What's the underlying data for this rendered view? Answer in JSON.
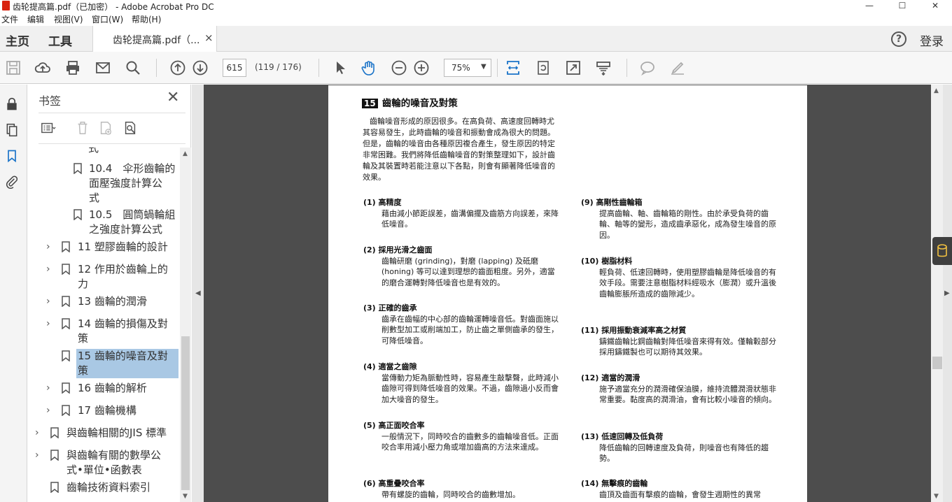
{
  "window": {
    "title": "齿轮提高篇.pdf（已加密） - Adobe Acrobat Pro DC",
    "minimize": "—",
    "maximize": "☐",
    "close": "✕"
  },
  "menu": [
    "文件",
    "编辑",
    "视图(V)",
    "窗口(W)",
    "帮助(H)"
  ],
  "tabs": {
    "home": "主页",
    "tools": "工具",
    "document": "齿轮提高篇.pdf（...",
    "close": "×",
    "help": "?",
    "login": "登录"
  },
  "toolbar": {
    "page_number": "615",
    "page_count": "(119 / 176)",
    "zoom": "75%"
  },
  "bookmarks": {
    "title": "书签",
    "close": "✕",
    "items": [
      {
        "text": "式"
      },
      {
        "text": "10.4　伞形齒輪的"
      },
      {
        "text": "面壓強度計算公"
      },
      {
        "text": "式"
      },
      {
        "text": "10.5　圓筒蝸輪組"
      },
      {
        "text": "之強度計算公式"
      },
      {
        "text": "11 塑膠齒輪的設計"
      },
      {
        "text": "12 作用於齒輪上的"
      },
      {
        "text": "力"
      },
      {
        "text": "13 齒輪的潤滑"
      },
      {
        "text": "14 齒輪的損傷及對"
      },
      {
        "text": "策"
      },
      {
        "text": "15 齒輪的噪音及對"
      },
      {
        "text": "策"
      },
      {
        "text": "16 齒輪的解析"
      },
      {
        "text": "17 齒輪機構"
      },
      {
        "text": "與齒輪相關的JIS 標準"
      },
      {
        "text": "與齒輪有關的數學公"
      },
      {
        "text": "式•單位•函數表"
      },
      {
        "text": "齒輪技術資料索引"
      }
    ]
  },
  "page": {
    "num": "15",
    "title": "齒輪的噪音及對策",
    "intro": "齒輪噪音形成的原因很多。在高負荷、高速度回轉時尤其容易發生，此時齒輪的噪音和振動會成為很大的問題。但是，齒輪的噪音由各種原因複合產生，發生原因的特定非常困難。我們將降低齒輪噪音的對策整理如下，設計齒輪及其裝置時若能注意以下各點，則會有顯著降低噪音的效果。",
    "left": [
      {
        "h": "(1)  高精度",
        "b": "藉由減小節距誤差，齒溝偏擺及齒筋方向誤差，來降低噪音。"
      },
      {
        "h": "(2)  採用光滑之齒面",
        "b": "齒輪研磨 (grinding)，對磨 (lapping) 及砥磨 (honing) 等可以達到理想的齒面粗度。另外，適當的磨合運轉對降低噪音也是有效的。"
      },
      {
        "h": "(3)  正確的齒承",
        "b": "齒承在齒幅的中心部的齒輪運轉噪音低。對齒面施以削數型加工或削端加工，防止齒之單側齒承的發生，可降低噪音。"
      },
      {
        "h": "(4)  適當之齒隙",
        "b": "當傳動力矩為脈動性時，容易產生敲擊聲，此時減小齒隙可得到降低噪音的效果。不過，齒隙過小反而會加大噪音的發生。"
      },
      {
        "h": "(5)  高正面咬合率",
        "b": "一般情況下，同時咬合的齒數多的齒輪噪音低。正面咬合率用減小壓力角或增加齒高的方法來達成。"
      },
      {
        "h": "(6)  高重疊咬合率",
        "b": "帶有螺旋的齒輪，同時咬合的齒數增加。"
      }
    ],
    "right": [
      {
        "h": "(9)  高剛性齒輪箱",
        "b": "提高齒輪、軸、齒輪箱的剛性。由於承受負荷的齒輪、軸等的變形，造成齒承惡化，成為發生噪音的原因。"
      },
      {
        "h": "(10)  樹脂材料",
        "b": "輕負荷、低速回轉時，使用塑膠齒輪是降低噪音的有效手段。需要注意樹脂材料經吸水（膨潤）或升溫後齒輪膨脹所造成的齒隙減少。"
      },
      {
        "h": "(11)  採用振動衰減率高之材質",
        "b": "鑄鐵齒輪比鋼齒輪對降低噪音來得有效。僅輪轂部分採用鑄鐵製也可以期待其效果。"
      },
      {
        "h": "(12)  適當的潤滑",
        "b": "施予適當充分的潤滑確保油膜，維持流體潤滑狀態非常重要。黏度高的潤滑油，會有比較小噪音的傾向。"
      },
      {
        "h": "(13)  低速回轉及低負荷",
        "b": "降低齒輪的回轉速度及負荷，則噪音也有降低的趨勢。"
      },
      {
        "h": "(14)  無擊痕的齒輪",
        "b": "齒頂及齒面有擊痕的齒輪，會發生週期性的異常"
      }
    ]
  }
}
